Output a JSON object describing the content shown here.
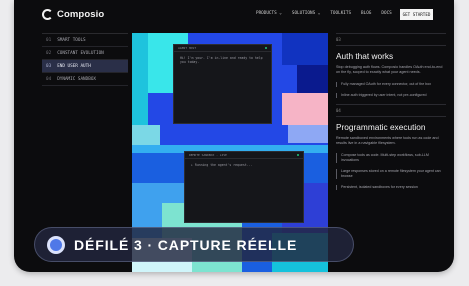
{
  "brand": {
    "name": "Composio"
  },
  "nav": {
    "links": [
      "PRODUCTS ⌄",
      "SOLUTIONS ⌄",
      "TOOLKITS",
      "BLOG",
      "DOCS"
    ],
    "cta": "GET STARTED"
  },
  "sidebar": {
    "items": [
      {
        "num": "01",
        "label": "SMART TOOLS"
      },
      {
        "num": "02",
        "label": "CONSTANT EVOLUTION"
      },
      {
        "num": "03",
        "label": "END USER AUTH",
        "active": true
      },
      {
        "num": "04",
        "label": "DYNAMIC SANDBOX"
      }
    ]
  },
  "terminals": {
    "top": {
      "title": "AGENT HOST",
      "text": "Hi! I'm your. I'm in-line and ready to help you today."
    },
    "bottom": {
      "title": "REMOTE SANDBOX · LIVE",
      "text": "▸ Running the agent's request..."
    }
  },
  "sections": [
    {
      "num": "03",
      "title": "Auth that works",
      "desc": "Stop debugging auth flows. Composio handles OAuth end-to-end on the fly, scoped to exactly what your agent needs.",
      "bullets": [
        "Fully managed OAuth for every connector, out of the box",
        "Inline auth triggered by user intent, not pre-configured"
      ]
    },
    {
      "num": "04",
      "title": "Programmatic execution",
      "desc": "Remote sandboxed environments where tools run as code and results live in a navigable filesystem.",
      "bullets": [
        "Compose tools as code. Multi-step workflows, sub-LLM invocations",
        "Large responses stored on a remote filesystem your agent can browse",
        "Persistent, isolated sandboxes for every session"
      ]
    }
  ],
  "overlay": {
    "label": "DÉFILÉ 3 · CAPTURE RÉELLE"
  },
  "colors": {
    "accent": "#4f78e8",
    "sidebar_active": "#2a2f48",
    "background": "#0c0c0e"
  }
}
